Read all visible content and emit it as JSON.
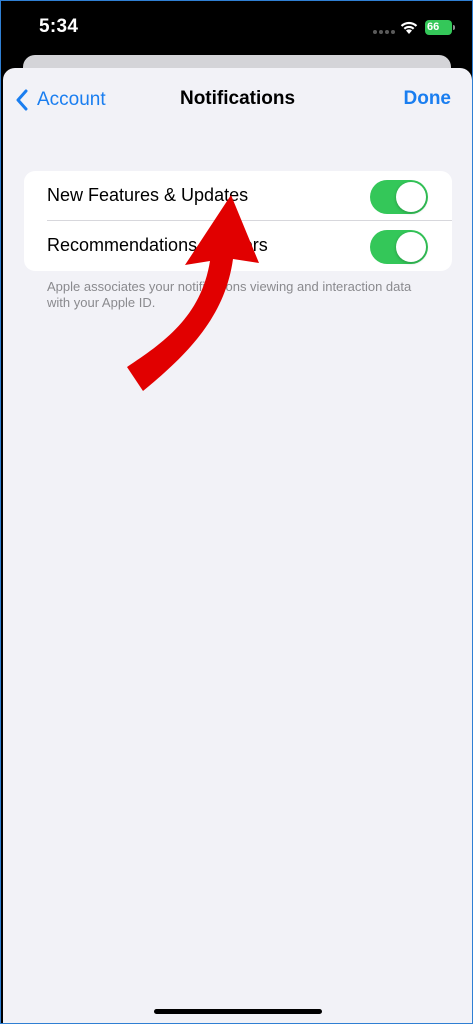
{
  "status_bar": {
    "time": "5:34",
    "battery_level": "66",
    "battery_color": "#34c759"
  },
  "nav": {
    "back_label": "Account",
    "title": "Notifications",
    "done_label": "Done",
    "accent_color": "#1a7ef0"
  },
  "settings": {
    "rows": [
      {
        "label": "New Features & Updates",
        "enabled": true
      },
      {
        "label": "Recommendations & Offers",
        "enabled": true
      }
    ],
    "footnote": "Apple associates your notifications viewing and interaction data with your Apple ID."
  },
  "annotation": {
    "type": "red-curved-arrow",
    "color": "#e10000"
  }
}
